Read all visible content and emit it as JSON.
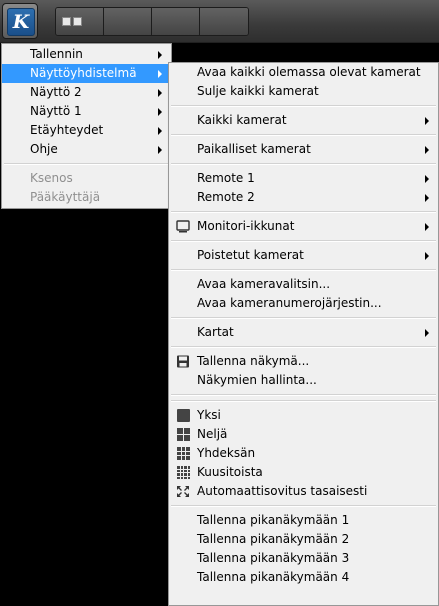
{
  "app": {
    "logo_letter": "K"
  },
  "colors": {
    "highlight": "#3399ff",
    "menu_bg": "#f0f0f0",
    "disabled_text": "#8f8f8f"
  },
  "menu1": {
    "items": [
      {
        "label": "Tallennin",
        "submenu": true
      },
      {
        "label": "Näyttöyhdistelmä",
        "submenu": true,
        "highlighted": true
      },
      {
        "label": "Näyttö 2",
        "submenu": true
      },
      {
        "label": "Näyttö 1",
        "submenu": true
      },
      {
        "label": "Etäyhteydet",
        "submenu": true
      },
      {
        "label": "Ohje",
        "submenu": true
      }
    ],
    "disabled_items": [
      "Ksenos",
      "Pääkäyttäjä"
    ]
  },
  "menu2": {
    "open_all": "Avaa kaikki olemassa olevat kamerat",
    "close_all": "Sulje kaikki kamerat",
    "all_cameras": "Kaikki kamerat",
    "local_cameras": "Paikalliset kamerat",
    "remote1": "Remote 1",
    "remote2": "Remote 2",
    "monitor_windows": "Monitori-ikkunat",
    "removed_cameras": "Poistetut kamerat",
    "open_selector": "Avaa kameravalitsin...",
    "open_sorter": "Avaa kameranumerojärjestin...",
    "maps": "Kartat",
    "save_view": "Tallenna näkymä...",
    "manage_views": "Näkymien hallinta...",
    "layout_one": "Yksi",
    "layout_four": "Neljä",
    "layout_nine": "Yhdeksän",
    "layout_sixteen": "Kuusitoista",
    "auto_fit": "Automaattisovitus tasaisesti",
    "quick_save_1": "Tallenna pikanäkymään 1",
    "quick_save_2": "Tallenna pikanäkymään 2",
    "quick_save_3": "Tallenna pikanäkymään 3",
    "quick_save_4": "Tallenna pikanäkymään 4"
  }
}
